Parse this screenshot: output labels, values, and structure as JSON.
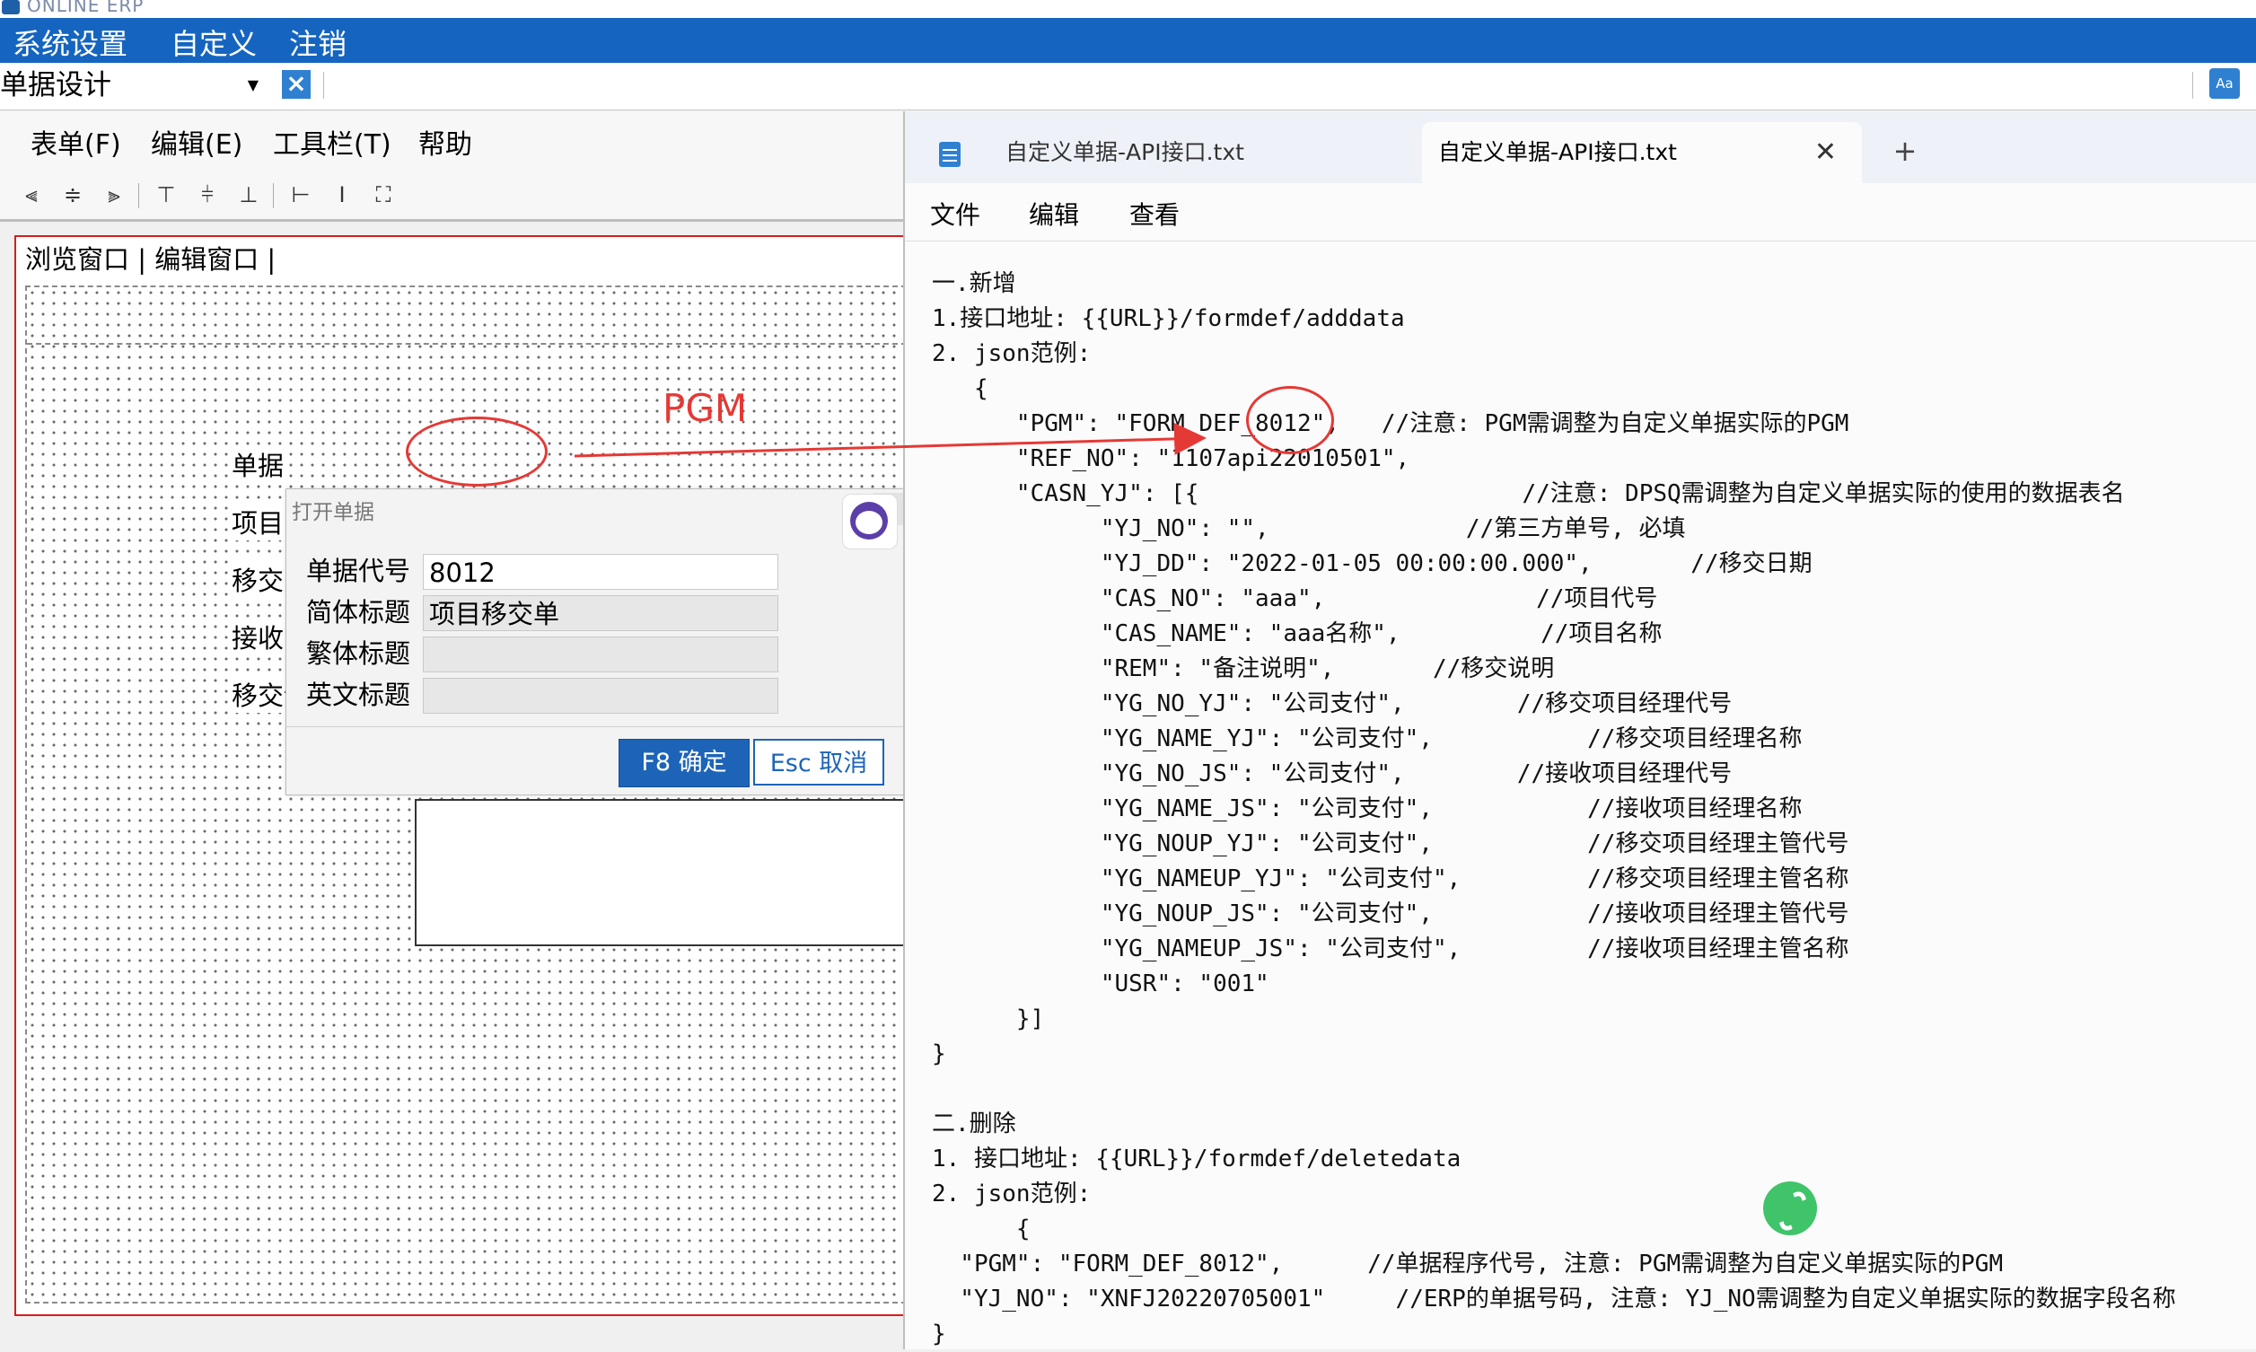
{
  "app": {
    "title": "ONLINE ERP"
  },
  "menubar": {
    "items": [
      "系统设置",
      "自定义",
      "注销"
    ]
  },
  "toolbar": {
    "doc_select_value": "单据设计",
    "font_icon": "Aa"
  },
  "designer": {
    "menu": [
      "表单(F)",
      "编辑(E)",
      "工具栏(T)",
      "帮助"
    ],
    "window_tabs": "浏览窗口 | 编辑窗口 |",
    "field_labels": [
      "单据",
      "项目",
      "移交",
      "接收",
      "移交说明"
    ]
  },
  "dialog": {
    "title": "打开单据",
    "fields": [
      {
        "label": "单据代号",
        "value": "8012"
      },
      {
        "label": "简体标题",
        "value": "项目移交单"
      },
      {
        "label": "繁体标题",
        "value": ""
      },
      {
        "label": "英文标题",
        "value": ""
      }
    ],
    "ok_label": "F8 确定",
    "cancel_label": "Esc 取消"
  },
  "annotation": {
    "label": "PGM",
    "color": "#e53935"
  },
  "notepad": {
    "tabs": [
      "自定义单据-API接口.txt",
      "自定义单据-API接口.txt"
    ],
    "menu": [
      "文件",
      "编辑",
      "查看"
    ],
    "content": "一.新增\n1.接口地址: {{URL}}/formdef/adddata\n2. json范例:\n   {\n      \"PGM\": \"FORM_DEF_8012\",   //注意: PGM需调整为自定义单据实际的PGM\n      \"REF_NO\": \"1107api22010501\",\n      \"CASN_YJ\": [{                       //注意: DPSQ需调整为自定义单据实际的使用的数据表名\n            \"YJ_NO\": \"\",              //第三方单号, 必填\n            \"YJ_DD\": \"2022-01-05 00:00:00.000\",       //移交日期\n            \"CAS_NO\": \"aaa\",               //项目代号\n            \"CAS_NAME\": \"aaa名称\",          //项目名称\n            \"REM\": \"备注说明\",       //移交说明\n            \"YG_NO_YJ\": \"公司支付\",        //移交项目经理代号\n            \"YG_NAME_YJ\": \"公司支付\",           //移交项目经理名称\n            \"YG_NO_JS\": \"公司支付\",        //接收项目经理代号\n            \"YG_NAME_JS\": \"公司支付\",           //接收项目经理名称\n            \"YG_NOUP_YJ\": \"公司支付\",           //移交项目经理主管代号\n            \"YG_NAMEUP_YJ\": \"公司支付\",         //移交项目经理主管名称\n            \"YG_NOUP_JS\": \"公司支付\",           //接收项目经理主管代号\n            \"YG_NAMEUP_JS\": \"公司支付\",         //接收项目经理主管名称\n            \"USR\": \"001\"\n      }]\n}\n\n二.删除\n1. 接口地址: {{URL}}/formdef/deletedata\n2. json范例:\n      {\n  \"PGM\": \"FORM_DEF_8012\",      //单据程序代号, 注意: PGM需调整为自定义单据实际的PGM\n  \"YJ_NO\": \"XNFJ20220705001\"     //ERP的单据号码, 注意: YJ_NO需调整为自定义单据实际的数据字段名称\n}"
  }
}
